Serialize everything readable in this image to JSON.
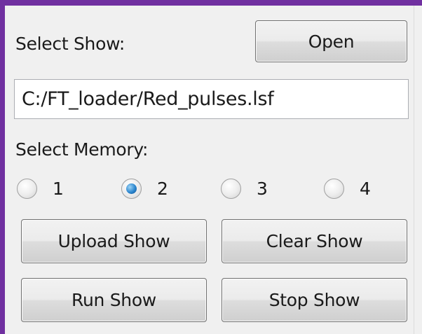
{
  "select_show": {
    "label": "Select Show:",
    "open_label": "Open",
    "path_value": "C:/FT_loader/Red_pulses.lsf"
  },
  "memory": {
    "label": "Select Memory:",
    "options": [
      "1",
      "2",
      "3",
      "4"
    ],
    "selected": "2"
  },
  "actions": {
    "upload_label": "Upload Show",
    "clear_label": "Clear Show",
    "run_label": "Run Show",
    "stop_label": "Stop Show"
  },
  "colors": {
    "frame": "#7030a0",
    "panel": "#f0f0f0",
    "radio_selected": "#2b86cf"
  }
}
